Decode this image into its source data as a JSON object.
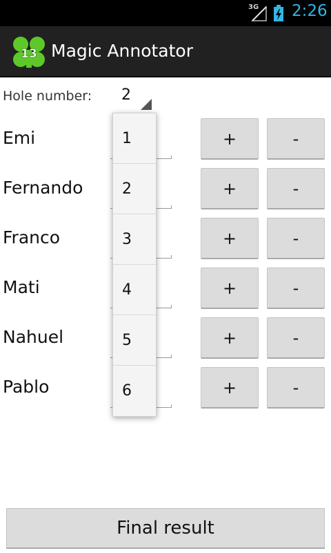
{
  "status_bar": {
    "network": "3G",
    "time": "2:26",
    "icons": [
      "signal-icon",
      "battery-charging-icon"
    ]
  },
  "app": {
    "title": "Magic Annotator",
    "icon": "app-logo-icon"
  },
  "hole": {
    "label": "Hole number:",
    "selected": "2",
    "options": [
      "1",
      "2",
      "3",
      "4",
      "5",
      "6"
    ]
  },
  "players": [
    {
      "name": "Emi",
      "plus": "+",
      "minus": "-"
    },
    {
      "name": "Fernando",
      "plus": "+",
      "minus": "-"
    },
    {
      "name": "Franco",
      "plus": "+",
      "minus": "-"
    },
    {
      "name": "Mati",
      "plus": "+",
      "minus": "-"
    },
    {
      "name": "Nahuel",
      "plus": "+",
      "minus": "-"
    },
    {
      "name": "Pablo",
      "plus": "+",
      "minus": "-"
    }
  ],
  "final_button": "Final result",
  "colors": {
    "status_bar": "#000000",
    "clock": "#33b5e5",
    "action_bar": "#212121",
    "button": "#dcdcdc",
    "logo_green": "#5ec82a"
  }
}
